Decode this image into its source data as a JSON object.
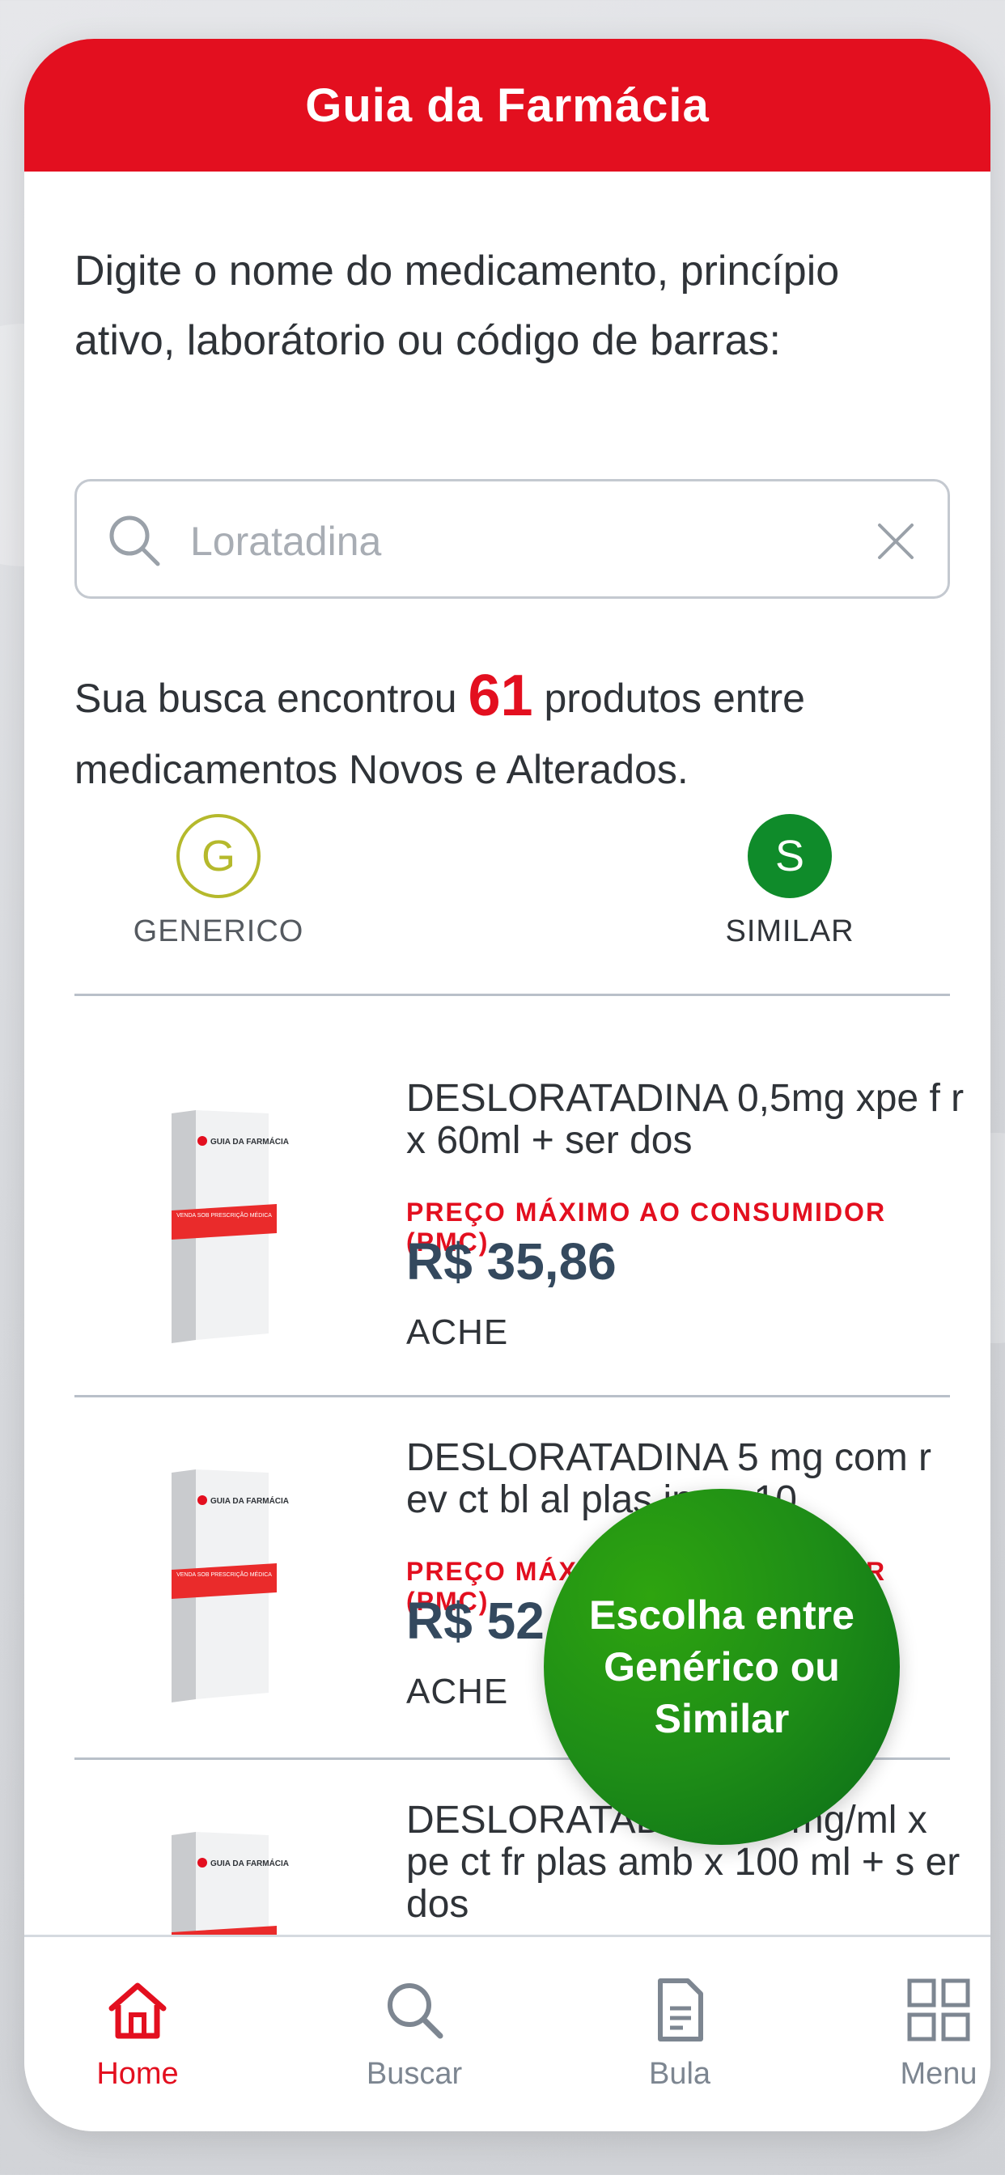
{
  "header": {
    "title": "Guia da Farmácia"
  },
  "instructions": "Digite o nome do medicamento, princípio ativo, laborátorio ou código de barras:",
  "search": {
    "placeholder": "Loratadina",
    "value": ""
  },
  "results": {
    "prefix": "Sua busca encontrou",
    "count": "61",
    "suffix": "produtos entre medicamentos Novos e Alterados."
  },
  "filters": [
    {
      "letter": "G",
      "label": "GENERICO"
    },
    {
      "letter": "S",
      "label": "SIMILAR"
    }
  ],
  "products": [
    {
      "name": "DESLORATADINA 0,5mg xpe f r x 60ml + ser dos",
      "price_label": "PREÇO MÁXIMO AO CONSUMIDOR (PMC)",
      "price": "R$ 35,86",
      "lab": "ACHE",
      "box_brand": "GUIA DA FARMÁCIA",
      "box_text": "VENDA SOB PRESCRIÇÃO MÉDICA"
    },
    {
      "name": "DESLORATADINA 5 mg com r ev ct bl al plas inc x 10",
      "price_label": "PREÇO MÁXIMO AO CONSUMIDOR (PMC)",
      "price": "R$ 52,54",
      "lab": "ACHE",
      "box_brand": "GUIA DA FARMÁCIA",
      "box_text": "VENDA SOB PRESCRIÇÃO MÉDICA"
    },
    {
      "name": "DESLORATADINA 0,5mg/ml x pe ct fr plas amb x 100 ml + s er dos",
      "price_label": "",
      "price": "",
      "lab": "",
      "box_brand": "GUIA DA FARMÁCIA",
      "box_text": ""
    }
  ],
  "fab": {
    "label": "Escolha entre Genérico ou Similar"
  },
  "nav": [
    {
      "label": "Home",
      "icon": "home-icon",
      "active": true
    },
    {
      "label": "Buscar",
      "icon": "search-icon"
    },
    {
      "label": "Bula",
      "icon": "document-icon"
    },
    {
      "label": "Menu",
      "icon": "grid-icon"
    }
  ],
  "colors": {
    "brand_red": "#e30f1f",
    "generic_yellow": "#b5b92c",
    "similar_green": "#0f8b2a",
    "text_dark": "#2f3338",
    "price_navy": "#34495e"
  }
}
